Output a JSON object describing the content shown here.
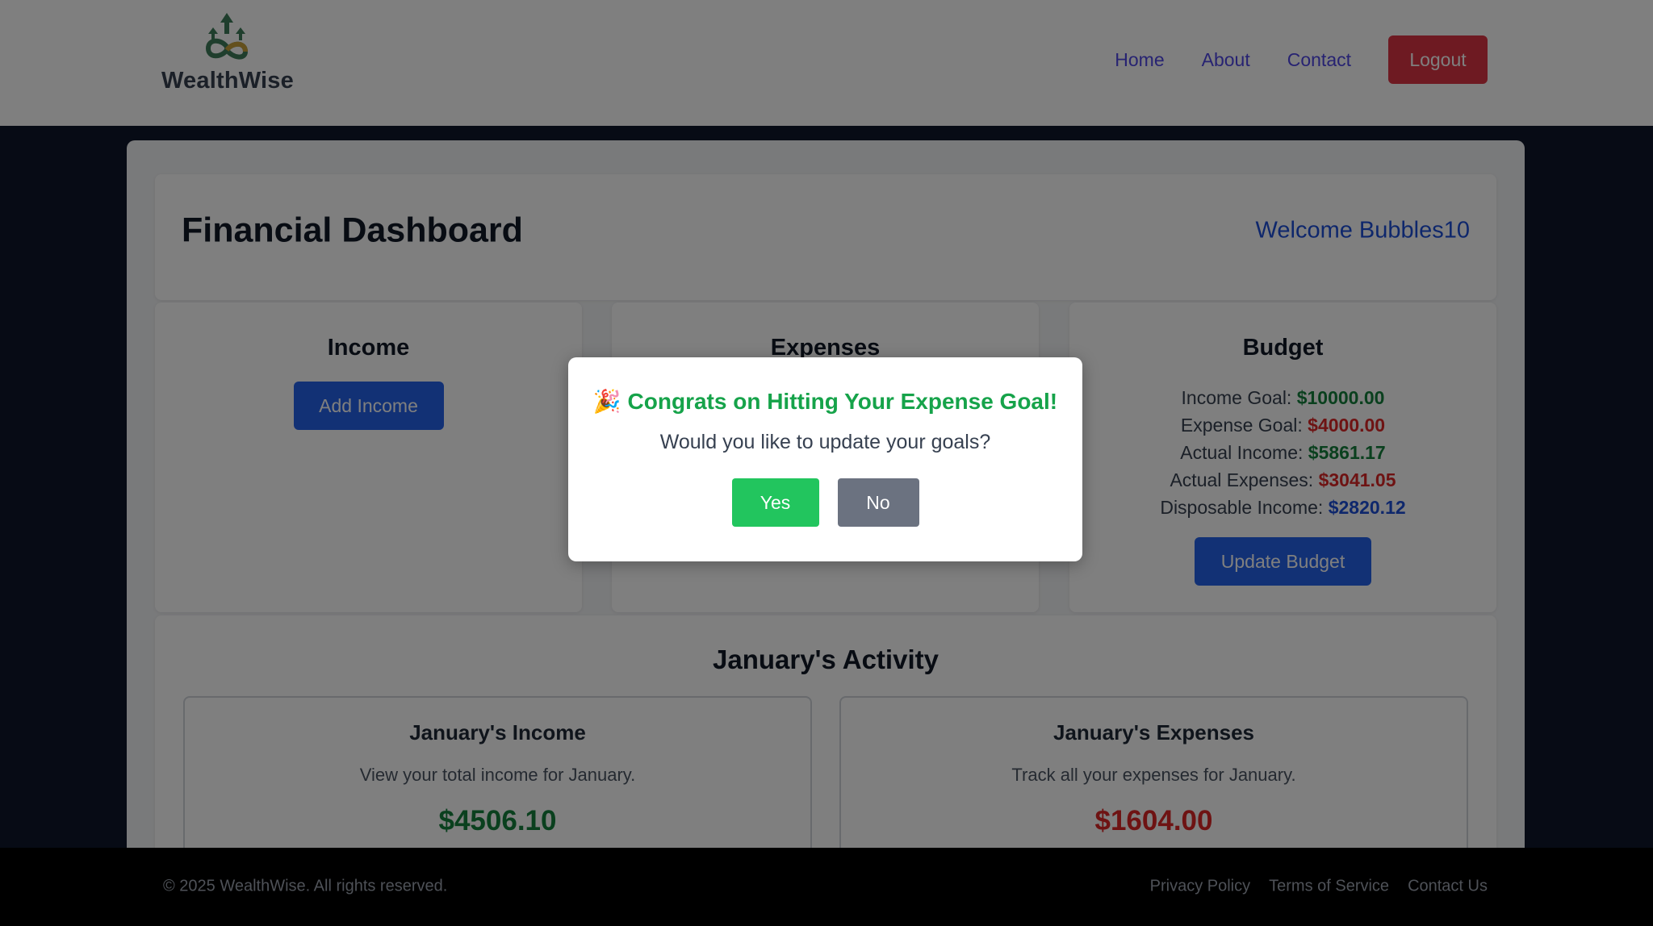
{
  "header": {
    "brand": "WealthWise",
    "nav": [
      "Home",
      "About",
      "Contact"
    ],
    "logout_label": "Logout"
  },
  "dashboard": {
    "title": "Financial Dashboard",
    "welcome": "Welcome Bubbles10"
  },
  "income": {
    "title": "Income",
    "add_label": "Add Income"
  },
  "expenses": {
    "title": "Expenses"
  },
  "budget": {
    "title": "Budget",
    "lines": [
      {
        "label": "Income Goal: ",
        "value": "$10000.00"
      },
      {
        "label": "Expense Goal: ",
        "value": "$4000.00"
      },
      {
        "label": "Actual Income: ",
        "value": "$5861.17"
      },
      {
        "label": "Actual Expenses: ",
        "value": "$3041.05"
      },
      {
        "label": "Disposable Income: ",
        "value": "$2820.12"
      }
    ],
    "update_label": "Update Budget"
  },
  "activity": {
    "title": "January's Activity",
    "income": {
      "title": "January's Income",
      "desc": "View your total income for January.",
      "amount": "$4506.10"
    },
    "expenses": {
      "title": "January's Expenses",
      "desc": "Track all your expenses for January.",
      "amount": "$1604.00"
    }
  },
  "footer": {
    "copyright": "© 2025 WealthWise. All rights reserved.",
    "links": [
      "Privacy Policy",
      "Terms of Service",
      "Contact Us"
    ]
  },
  "modal": {
    "emoji": "🎉",
    "title": "Congrats on Hitting Your Expense Goal!",
    "message": "Would you like to update your goals?",
    "yes_label": "Yes",
    "no_label": "No"
  },
  "colors": {
    "accent": "#2563eb",
    "danger": "#dc3545",
    "success": "#22c55e",
    "income_green": "#15803d",
    "expense_red": "#dc2626"
  }
}
